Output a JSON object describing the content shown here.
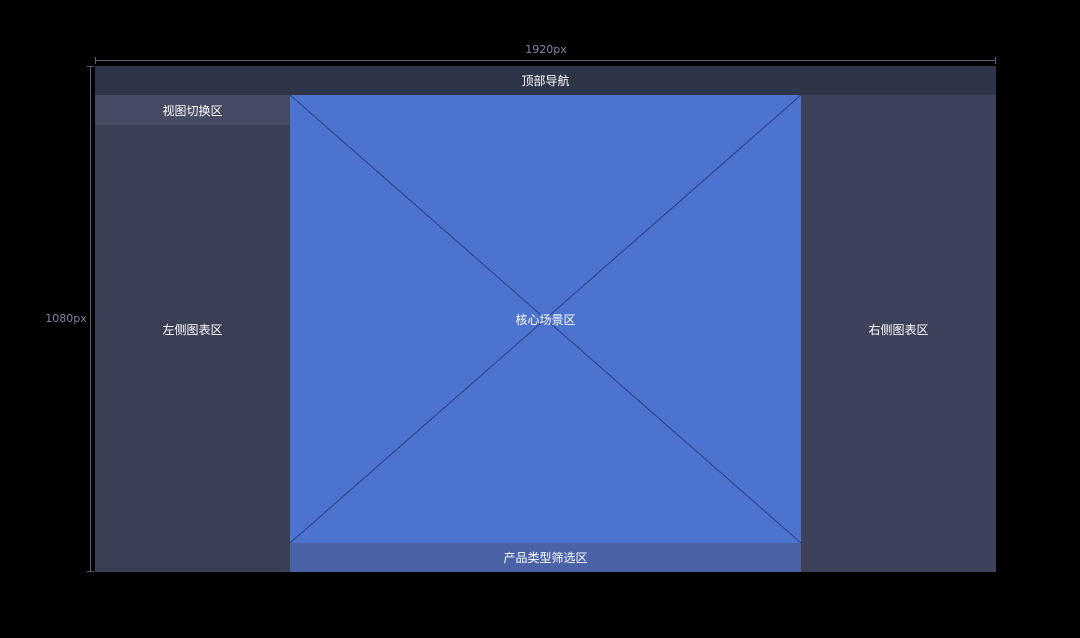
{
  "dimensions": {
    "width_label": "1920px",
    "height_label": "1080px"
  },
  "regions": {
    "top_nav": "顶部导航",
    "view_switch": "视图切换区",
    "left_chart_area": "左侧图表区",
    "core_scene": "核心场景区",
    "right_chart_area": "右侧图表区",
    "product_filter": "产品类型筛选区"
  },
  "colors": {
    "background": "#000000",
    "panel": "#3b3f56",
    "top_nav": "#2e3549",
    "view_switch": "#464b63",
    "core_scene": "#4d73d0",
    "filter_bar": "#4a63a8"
  }
}
